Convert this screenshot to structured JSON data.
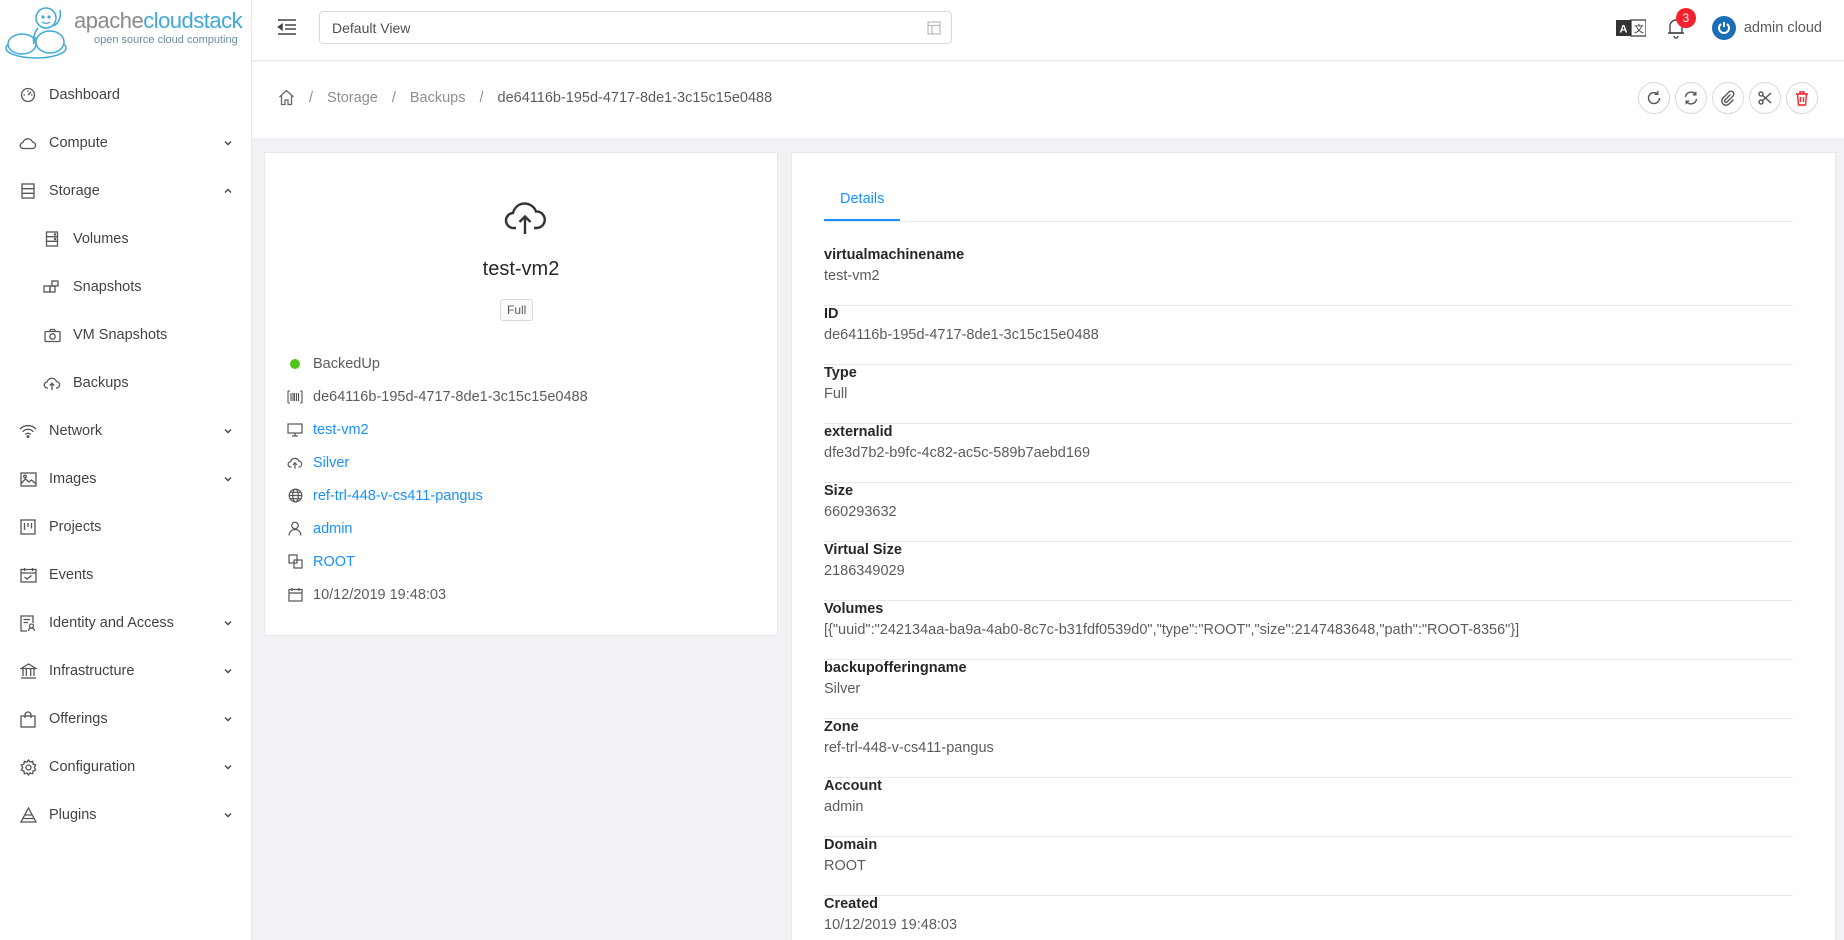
{
  "logo": {
    "part1": "apache",
    "part2": "cloudstack",
    "tagline": "open source cloud computing"
  },
  "sidebar": {
    "items": [
      {
        "label": "Dashboard",
        "icon": "dashboard-icon"
      },
      {
        "label": "Compute",
        "icon": "cloud-icon",
        "expandable": true
      },
      {
        "label": "Storage",
        "icon": "database-icon",
        "expanded": true
      },
      {
        "label": "Volumes",
        "icon": "hdd-icon",
        "sub": true
      },
      {
        "label": "Snapshots",
        "icon": "build-icon",
        "sub": true
      },
      {
        "label": "VM Snapshots",
        "icon": "camera-icon",
        "sub": true
      },
      {
        "label": "Backups",
        "icon": "cloud-upload-icon",
        "sub": true
      },
      {
        "label": "Network",
        "icon": "wifi-icon",
        "expandable": true
      },
      {
        "label": "Images",
        "icon": "picture-icon",
        "expandable": true
      },
      {
        "label": "Projects",
        "icon": "project-icon"
      },
      {
        "label": "Events",
        "icon": "schedule-icon"
      },
      {
        "label": "Identity and Access",
        "icon": "solution-icon",
        "expandable": true
      },
      {
        "label": "Infrastructure",
        "icon": "bank-icon",
        "expandable": true
      },
      {
        "label": "Offerings",
        "icon": "shopping-icon",
        "expandable": true
      },
      {
        "label": "Configuration",
        "icon": "setting-icon",
        "expandable": true
      },
      {
        "label": "Plugins",
        "icon": "plugins-icon",
        "expandable": true
      }
    ]
  },
  "header": {
    "view_select": "Default View",
    "notification_count": "3",
    "user_name": "admin cloud"
  },
  "breadcrumb": {
    "items": [
      "Storage",
      "Backups"
    ],
    "current": "de64116b-195d-4717-8de1-3c15c15e0488"
  },
  "resource": {
    "name": "test-vm2",
    "tag": "Full",
    "status": "BackedUp",
    "id": "de64116b-195d-4717-8de1-3c15c15e0488",
    "vm": "test-vm2",
    "offering": "Silver",
    "zone": "ref-trl-448-v-cs411-pangus",
    "account": "admin",
    "domain": "ROOT",
    "created": "10/12/2019 19:48:03",
    "status_color": "#52c41a"
  },
  "tabs": {
    "details": "Details"
  },
  "details": [
    {
      "key": "virtualmachinename",
      "value": "test-vm2"
    },
    {
      "key": "ID",
      "value": "de64116b-195d-4717-8de1-3c15c15e0488"
    },
    {
      "key": "Type",
      "value": "Full"
    },
    {
      "key": "externalid",
      "value": "dfe3d7b2-b9fc-4c82-ac5c-589b7aebd169"
    },
    {
      "key": "Size",
      "value": "660293632"
    },
    {
      "key": "Virtual Size",
      "value": "2186349029"
    },
    {
      "key": "Volumes",
      "value": "[{\"uuid\":\"242134aa-ba9a-4ab0-8c7c-b31fdf0539d0\",\"type\":\"ROOT\",\"size\":2147483648,\"path\":\"ROOT-8356\"}]"
    },
    {
      "key": "backupofferingname",
      "value": "Silver"
    },
    {
      "key": "Zone",
      "value": "ref-trl-448-v-cs411-pangus"
    },
    {
      "key": "Account",
      "value": "admin"
    },
    {
      "key": "Domain",
      "value": "ROOT"
    },
    {
      "key": "Created",
      "value": "10/12/2019 19:48:03"
    }
  ],
  "colors": {
    "accent": "#1890ff",
    "danger": "#f5222d",
    "logo_blue": "#3fa9d6"
  }
}
